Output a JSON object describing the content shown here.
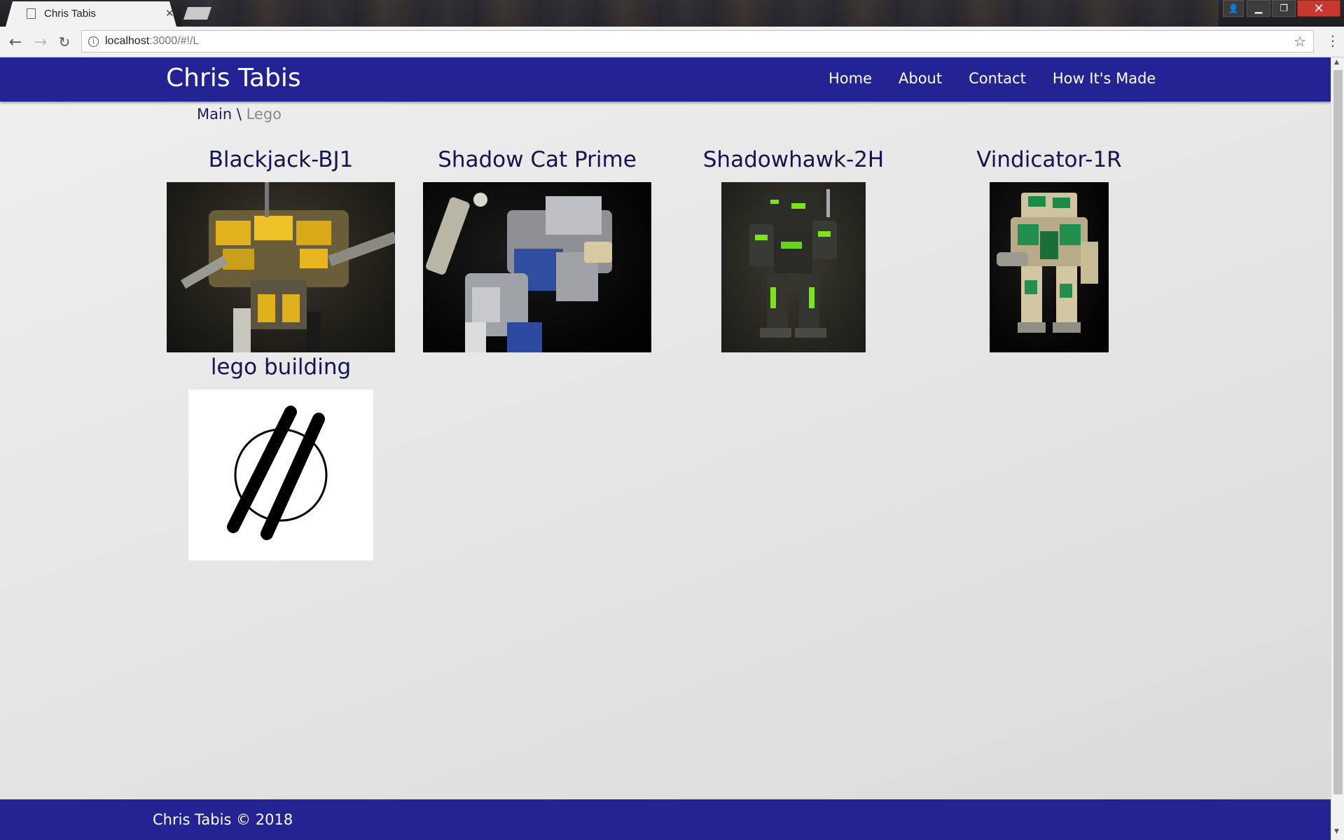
{
  "browser": {
    "tab_title": "Chris Tabis",
    "url_host": "localhost",
    "url_rest": ":3000/#!/L"
  },
  "site": {
    "title": "Chris Tabis",
    "nav": [
      {
        "label": "Home"
      },
      {
        "label": "About"
      },
      {
        "label": "Contact"
      },
      {
        "label": "How It's Made"
      }
    ],
    "breadcrumb": {
      "main": "Main",
      "separator": "\\",
      "current": "Lego"
    },
    "gallery": [
      {
        "title": "Blackjack-BJ1",
        "image": "yellow-mech-photo"
      },
      {
        "title": "Shadow Cat Prime",
        "image": "white-blue-mech-photo"
      },
      {
        "title": "Shadowhawk-2H",
        "image": "green-mech-photo"
      },
      {
        "title": "Vindicator-1R",
        "image": "green-tan-mech-photo"
      },
      {
        "title": "lego building",
        "image": "slashed-circle-logo"
      }
    ],
    "footer": "Chris Tabis © 2018"
  },
  "colors": {
    "brand": "#232394",
    "title_text": "#14144e"
  }
}
